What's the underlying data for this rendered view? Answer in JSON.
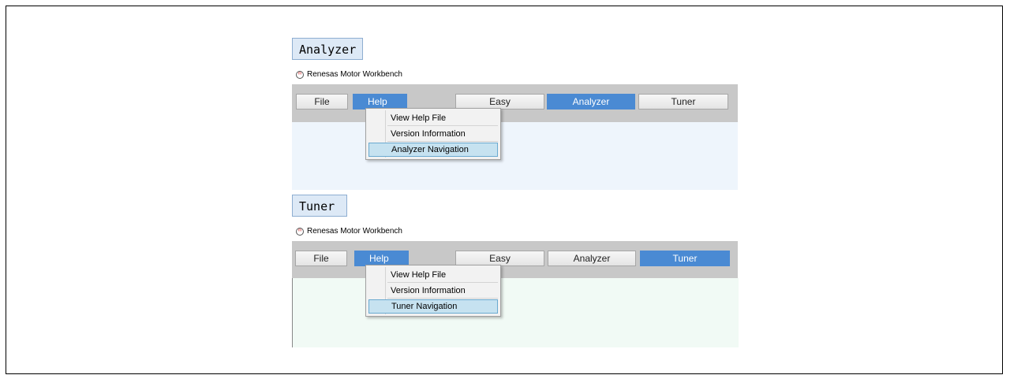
{
  "sections": [
    {
      "label": "Analyzer",
      "app_title": "Renesas Motor Workbench",
      "toolbar": {
        "file": "File",
        "help": "Help",
        "easy": "Easy",
        "analyzer": "Analyzer",
        "tuner": "Tuner",
        "active_mode": "Analyzer"
      },
      "help_menu": [
        "View Help File",
        "Version Information",
        "Analyzer Navigation"
      ],
      "highlighted_item": "Analyzer Navigation",
      "content_bg": "#eef5fc"
    },
    {
      "label": "Tuner",
      "app_title": "Renesas Motor Workbench",
      "toolbar": {
        "file": "File",
        "help": "Help",
        "easy": "Easy",
        "analyzer": "Analyzer",
        "tuner": "Tuner",
        "active_mode": "Tuner"
      },
      "help_menu": [
        "View Help File",
        "Version Information",
        "Tuner Navigation"
      ],
      "highlighted_item": "Tuner Navigation",
      "content_bg": "#f1faf5"
    }
  ],
  "colors": {
    "accent": "#4a8ad3",
    "toolbar_bg": "#c8c8c8",
    "menu_highlight": "#c6e2f0",
    "label_bg": "#dde9f6"
  },
  "icons": {
    "app_logo": "renesas-logo-icon"
  }
}
